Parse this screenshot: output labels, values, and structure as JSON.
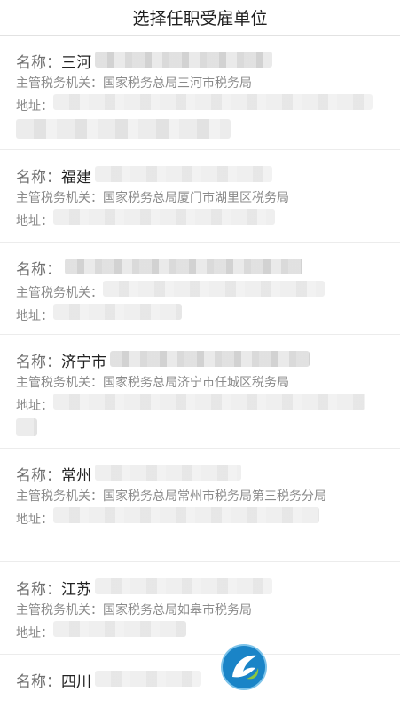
{
  "header": {
    "title": "选择任职受雇单位"
  },
  "labels": {
    "name": "名称：",
    "authority": "主管税务机关：",
    "address": "地址："
  },
  "items": [
    {
      "name_prefix": "三河",
      "authority": "国家税务总局三河市税务局"
    },
    {
      "name_prefix": "福建",
      "authority": "国家税务总局厦门市湖里区税务局"
    },
    {
      "name_prefix": "",
      "authority": ""
    },
    {
      "name_prefix": "济宁市",
      "authority": "国家税务总局济宁市任城区税务局"
    },
    {
      "name_prefix": "常州",
      "authority": "国家税务总局常州市税务局第三税务分局"
    },
    {
      "name_prefix": "江苏",
      "authority": "国家税务总局如皋市税务局"
    },
    {
      "name_prefix": "四川",
      "authority": ""
    }
  ]
}
